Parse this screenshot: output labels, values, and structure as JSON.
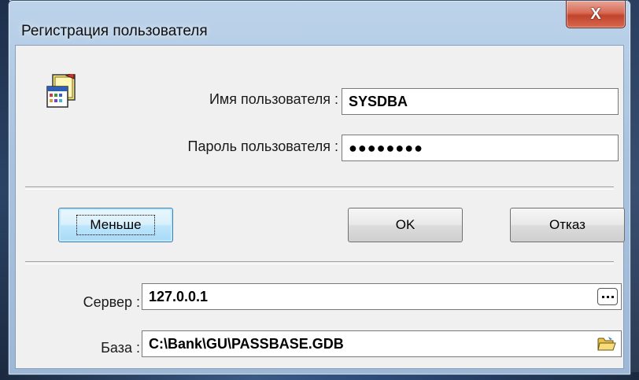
{
  "window": {
    "title": "Регистрация пользователя",
    "close_glyph": "X"
  },
  "login": {
    "username_label": "Имя пользователя :",
    "username_value": "SYSDBA",
    "password_label": "Пароль пользователя :",
    "password_value": "●●●●●●●●"
  },
  "buttons": {
    "less_label": "Меньше",
    "ok_label": "OK",
    "cancel_label": "Отказ"
  },
  "connection": {
    "server_label": "Сервер :",
    "server_value": "127.0.0.1",
    "database_label": "База :",
    "database_value": "C:\\Bank\\GU\\PASSBASE.GDB"
  },
  "icons": {
    "app": "user-registration-app-icon",
    "browse_server": "ellipsis-icon",
    "browse_database": "open-folder-icon",
    "close": "close-icon"
  },
  "colors": {
    "title_bar": "#a9c3df",
    "close_button": "#c2432c",
    "dialog_bg": "#f0f0f0",
    "focused_button": "#bee6fd"
  }
}
